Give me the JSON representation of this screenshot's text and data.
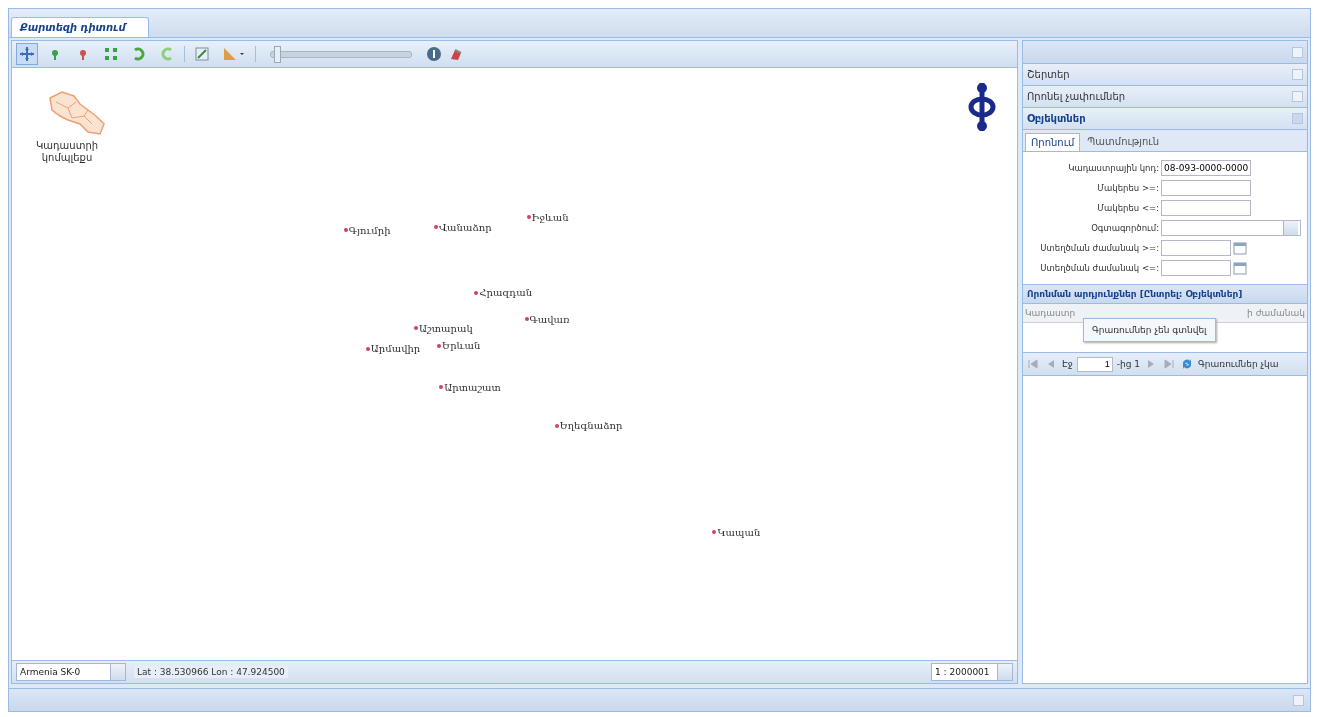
{
  "tabs": [
    {
      "label": "Քարտեզի դիտում",
      "selected": true
    }
  ],
  "toolbar": {
    "tools": [
      {
        "kind": "pan",
        "selected": true
      },
      {
        "kind": "zoom-in",
        "selected": false
      },
      {
        "kind": "zoom-out",
        "selected": false
      },
      {
        "kind": "extent",
        "selected": false
      },
      {
        "kind": "undo",
        "selected": false
      },
      {
        "kind": "redo",
        "selected": false
      },
      {
        "kind": "measure",
        "selected": false
      },
      {
        "kind": "ruler",
        "selected": false
      }
    ],
    "zoom_slider": {
      "level": 0.02
    }
  },
  "map": {
    "overview_label": "Կադաստրի կոմպլեքս",
    "places": [
      {
        "name": "Գյումրի"
      },
      {
        "name": "Վանաձոր"
      },
      {
        "name": "Իջևան"
      },
      {
        "name": "Հրազդան"
      },
      {
        "name": "Գավառ"
      },
      {
        "name": "Աշտարակ"
      },
      {
        "name": "Արմավիր"
      },
      {
        "name": "Երևան"
      },
      {
        "name": "Արտաշատ"
      },
      {
        "name": "Եղեգնաձոր"
      },
      {
        "name": "Կապան"
      }
    ]
  },
  "map_footer": {
    "projection": "Armenia SK-0",
    "coordinates": "Lat : 38.530966 Lon : 47.924500",
    "scale": "1 : 2000001"
  },
  "side_panel": {
    "sections": [
      {
        "title": "Շերտեր",
        "expanded": false
      },
      {
        "title": "Որոնել չափումներ",
        "expanded": false
      },
      {
        "title": "Օբյեկտներ",
        "expanded": true
      }
    ],
    "subtabs": [
      {
        "label": "Որոնում",
        "selected": true
      },
      {
        "label": "Պատմություն",
        "selected": false
      }
    ],
    "fields": [
      {
        "kind": "text",
        "label": "Կադաստրային կոդ:",
        "value": "08-093-0000-0000"
      },
      {
        "kind": "text",
        "label": "Մակերես >=:"
      },
      {
        "kind": "text",
        "label": "Մակերես <=:"
      },
      {
        "kind": "select",
        "label": "Օգտագործում:"
      },
      {
        "kind": "date",
        "label": "Ստեղծման ժամանակ >=:"
      },
      {
        "kind": "date",
        "label": "Ստեղծման ժամանակ <=:"
      }
    ],
    "results": {
      "title": "Որոնման արդյունքներ [Ընտրել: Օբյեկտներ]",
      "columns": [
        "Կադաստր",
        "ի ժամանակ"
      ],
      "message": "Գրառումներ չեն գտնվել",
      "page_label": "Էջ",
      "page": "1",
      "page_of": "-ից 1",
      "status": "Գրառումներ չկա"
    }
  }
}
